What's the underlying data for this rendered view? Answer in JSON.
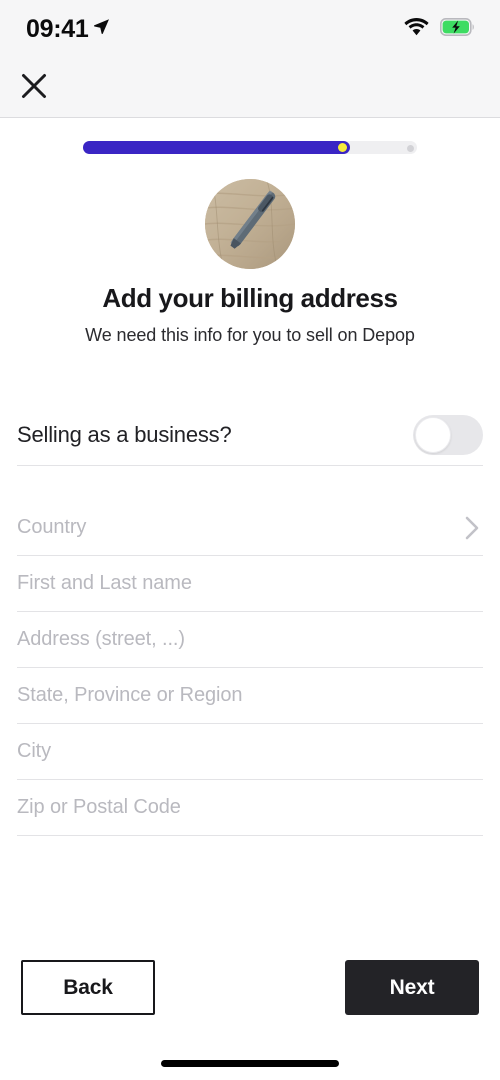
{
  "status_bar": {
    "time": "09:41",
    "location_icon": "location-arrow-icon",
    "wifi_icon": "wifi-icon",
    "battery_icon": "battery-charging-icon",
    "battery_color": "#3ddc62"
  },
  "header": {
    "close_icon": "close-icon"
  },
  "progress": {
    "percent": 80,
    "fill_color": "#3a25c4",
    "track_color": "#efeff1",
    "knob_color": "#f5ea3c",
    "dot_color": "#d2d2d6"
  },
  "avatar": {
    "name": "profile-avatar",
    "description": "pen on wooden surface"
  },
  "main": {
    "title": "Add your billing address",
    "subtitle": "We need this info for you to sell on Depop"
  },
  "business_toggle": {
    "label": "Selling as a business?",
    "state": "off"
  },
  "form": {
    "fields": [
      {
        "placeholder": "Country",
        "name": "country-field",
        "chevron": true
      },
      {
        "placeholder": "First and Last name",
        "name": "name-field",
        "chevron": false
      },
      {
        "placeholder": "Address (street, ...)",
        "name": "address-field",
        "chevron": false
      },
      {
        "placeholder": "State, Province or Region",
        "name": "state-field",
        "chevron": false
      },
      {
        "placeholder": "City",
        "name": "city-field",
        "chevron": false
      },
      {
        "placeholder": "Zip or Postal Code",
        "name": "zip-field",
        "chevron": false
      }
    ]
  },
  "footer": {
    "back_label": "Back",
    "next_label": "Next",
    "next_bg": "#232327"
  }
}
